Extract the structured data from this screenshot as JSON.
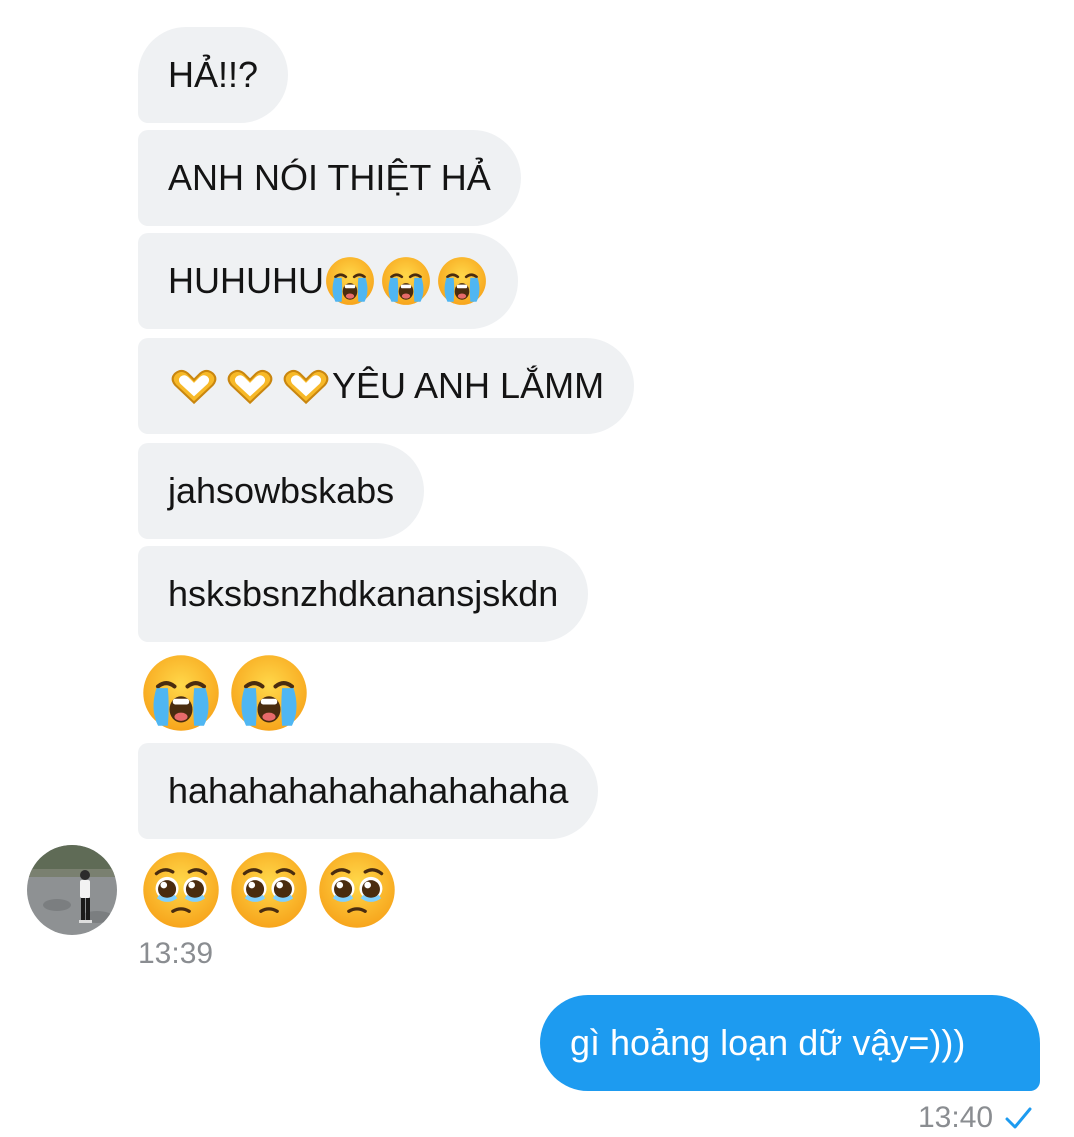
{
  "messages_in": [
    "HẢ!!?",
    "ANH NÓI THIỆT HẢ",
    "HUHUHU",
    "YÊU ANH LẮMM",
    "jahsowbskabs",
    "hsksbsnzhdkanansjskdn",
    "hahahahahahahahahaha"
  ],
  "incoming_time": "13:39",
  "outgoing": {
    "text": "gì hoảng loạn dữ vậy=)))",
    "time": "13:40",
    "status_icon": "check-icon"
  },
  "colors": {
    "incoming_bubble": "#eff1f3",
    "outgoing_bubble": "#1d9bf0",
    "timestamp": "#8a8d91",
    "check": "#1d9bf0"
  },
  "emoji_names": {
    "crying": "loudly-crying-face",
    "heart_hands": "heart-hands",
    "pleading": "pleading-face"
  }
}
